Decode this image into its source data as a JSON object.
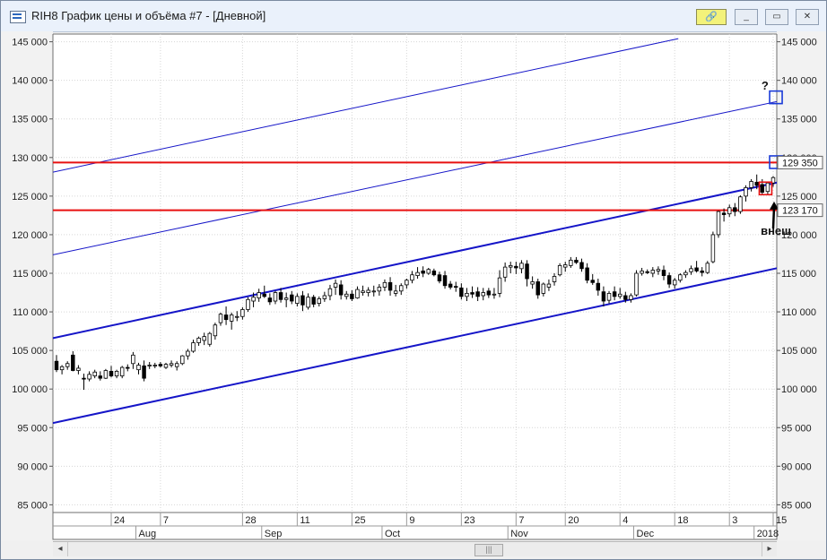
{
  "window": {
    "title": "RIH8 График цены и объёма #7 - [Дневной]",
    "icon": "chart-window-icon",
    "buttons": {
      "link": "🔗",
      "minimize": "_",
      "restore": "▭",
      "close": "✕"
    }
  },
  "chart_data": {
    "type": "candlestick",
    "title": "",
    "xlabel": "",
    "ylabel": "",
    "ylim": [
      84000,
      146000
    ],
    "y_ticks": [
      85000,
      90000,
      95000,
      100000,
      105000,
      110000,
      115000,
      120000,
      125000,
      130000,
      135000,
      140000,
      145000
    ],
    "y_tick_labels": [
      "85 000",
      "90 000",
      "95 000",
      "100 000",
      "105 000",
      "110 000",
      "115 000",
      "120 000",
      "125 000",
      "130 000",
      "135 000",
      "140 000",
      "145 000"
    ],
    "grid": true,
    "x_tick_labels": [
      {
        "label": "24",
        "bar": 10
      },
      {
        "label": "7",
        "bar": 19
      },
      {
        "label": "28",
        "bar": 34
      },
      {
        "label": "11",
        "bar": 44
      },
      {
        "label": "25",
        "bar": 54
      },
      {
        "label": "9",
        "bar": 64
      },
      {
        "label": "23",
        "bar": 74
      },
      {
        "label": "7",
        "bar": 84
      },
      {
        "label": "20",
        "bar": 93
      },
      {
        "label": "4",
        "bar": 103
      },
      {
        "label": "18",
        "bar": 113
      },
      {
        "label": "3",
        "bar": 123
      },
      {
        "label": "15",
        "bar": 131
      }
    ],
    "month_labels": [
      {
        "label": "Aug",
        "bar": 15
      },
      {
        "label": "Sep",
        "bar": 38
      },
      {
        "label": "Oct",
        "bar": 60
      },
      {
        "label": "Nov",
        "bar": 83
      },
      {
        "label": "Dec",
        "bar": 106
      },
      {
        "label": "2018",
        "bar": 128
      }
    ],
    "candles": [
      [
        103600,
        104400,
        102200,
        102500
      ],
      [
        102500,
        103100,
        101900,
        102900
      ],
      [
        102900,
        103600,
        102500,
        103300
      ],
      [
        104400,
        104900,
        102300,
        102400
      ],
      [
        102400,
        103100,
        101900,
        102700
      ],
      [
        101400,
        102000,
        99900,
        101300
      ],
      [
        101300,
        102300,
        101000,
        101900
      ],
      [
        101700,
        102500,
        101400,
        102200
      ],
      [
        101700,
        102300,
        101100,
        101400
      ],
      [
        101400,
        102600,
        101300,
        102400
      ],
      [
        102300,
        103000,
        101500,
        101700
      ],
      [
        101700,
        102500,
        101400,
        102300
      ],
      [
        101700,
        103000,
        101400,
        102800
      ],
      [
        102800,
        103200,
        102300,
        102700
      ],
      [
        103300,
        104800,
        102600,
        104400
      ],
      [
        102500,
        103400,
        101900,
        103100
      ],
      [
        103000,
        103700,
        101000,
        101400
      ],
      [
        103000,
        103500,
        102600,
        103100
      ],
      [
        103000,
        103400,
        102700,
        103100
      ],
      [
        103200,
        103500,
        102800,
        103000
      ],
      [
        102800,
        103400,
        102600,
        103200
      ],
      [
        103100,
        103700,
        102800,
        103300
      ],
      [
        102900,
        103600,
        102400,
        103300
      ],
      [
        103300,
        104400,
        103100,
        104300
      ],
      [
        104300,
        105200,
        103800,
        104900
      ],
      [
        104900,
        106400,
        104700,
        106000
      ],
      [
        106000,
        106800,
        105600,
        106600
      ],
      [
        106300,
        107300,
        105700,
        106800
      ],
      [
        105800,
        107400,
        105500,
        107200
      ],
      [
        106900,
        108600,
        106400,
        108300
      ],
      [
        108600,
        109900,
        108200,
        109700
      ],
      [
        109600,
        110700,
        108300,
        109000
      ],
      [
        108800,
        109900,
        107700,
        109600
      ],
      [
        109300,
        110100,
        108800,
        109400
      ],
      [
        109400,
        110600,
        109000,
        110300
      ],
      [
        110300,
        111900,
        110000,
        111600
      ],
      [
        111400,
        112500,
        110600,
        111900
      ],
      [
        111800,
        113000,
        111300,
        112500
      ],
      [
        112300,
        113400,
        111800,
        112000
      ],
      [
        111800,
        112400,
        110900,
        111300
      ],
      [
        111400,
        112700,
        111000,
        112500
      ],
      [
        112500,
        113100,
        111200,
        111600
      ],
      [
        111600,
        112500,
        110600,
        111800
      ],
      [
        112200,
        112700,
        111000,
        111400
      ],
      [
        111100,
        112400,
        110700,
        112000
      ],
      [
        112100,
        112700,
        110100,
        110900
      ],
      [
        110600,
        112400,
        110300,
        111900
      ],
      [
        111900,
        112200,
        110600,
        111000
      ],
      [
        111100,
        112000,
        110700,
        111700
      ],
      [
        111700,
        112600,
        111300,
        112100
      ],
      [
        112100,
        113500,
        111500,
        113000
      ],
      [
        113200,
        114200,
        112200,
        113700
      ],
      [
        113500,
        114100,
        111600,
        112200
      ],
      [
        112000,
        112700,
        111600,
        112300
      ],
      [
        112300,
        112800,
        111400,
        111700
      ],
      [
        111800,
        113300,
        111700,
        112900
      ],
      [
        112500,
        113400,
        112100,
        112700
      ],
      [
        112500,
        113200,
        112000,
        112800
      ],
      [
        112700,
        113400,
        112000,
        112700
      ],
      [
        112700,
        113600,
        112100,
        113200
      ],
      [
        113200,
        114200,
        112700,
        113800
      ],
      [
        113800,
        114500,
        112100,
        112800
      ],
      [
        112400,
        113500,
        112000,
        112700
      ],
      [
        112700,
        113700,
        112200,
        113400
      ],
      [
        113500,
        114300,
        113000,
        114100
      ],
      [
        114100,
        115300,
        113700,
        114800
      ],
      [
        114700,
        115800,
        114300,
        115100
      ],
      [
        115300,
        115900,
        114500,
        115000
      ],
      [
        115000,
        115700,
        114800,
        115500
      ],
      [
        115300,
        115600,
        114600,
        114800
      ],
      [
        114800,
        115200,
        113700,
        114000
      ],
      [
        114700,
        115300,
        113000,
        113400
      ],
      [
        113600,
        114000,
        112900,
        113200
      ],
      [
        113300,
        113900,
        112600,
        113200
      ],
      [
        113100,
        113700,
        111600,
        112000
      ],
      [
        112000,
        113100,
        111400,
        112400
      ],
      [
        112500,
        113300,
        111800,
        112300
      ],
      [
        112600,
        113200,
        111400,
        112000
      ],
      [
        112100,
        113100,
        111500,
        112500
      ],
      [
        112700,
        113100,
        111800,
        112200
      ],
      [
        112300,
        113100,
        111700,
        112300
      ],
      [
        112400,
        115400,
        111900,
        114400
      ],
      [
        114500,
        116400,
        113900,
        115800
      ],
      [
        115800,
        116500,
        115000,
        116000
      ],
      [
        115900,
        116500,
        114900,
        115700
      ],
      [
        115600,
        116700,
        115000,
        116300
      ],
      [
        116200,
        116700,
        113300,
        114300
      ],
      [
        113600,
        114600,
        113000,
        113900
      ],
      [
        113900,
        114300,
        111700,
        112200
      ],
      [
        112400,
        113800,
        112000,
        113600
      ],
      [
        113200,
        114200,
        112700,
        113600
      ],
      [
        113900,
        115000,
        113400,
        114600
      ],
      [
        114800,
        116300,
        114600,
        116000
      ],
      [
        115800,
        116500,
        115200,
        116100
      ],
      [
        116000,
        117100,
        115700,
        116700
      ],
      [
        116700,
        117100,
        116200,
        116400
      ],
      [
        116400,
        116900,
        115200,
        115600
      ],
      [
        115700,
        116300,
        113700,
        114100
      ],
      [
        114100,
        114900,
        113500,
        113800
      ],
      [
        113700,
        114300,
        112100,
        112800
      ],
      [
        112600,
        113300,
        110700,
        111400
      ],
      [
        111500,
        112700,
        111100,
        112400
      ],
      [
        112600,
        113300,
        111500,
        112000
      ],
      [
        112000,
        113100,
        111700,
        112300
      ],
      [
        112100,
        112600,
        111200,
        111600
      ],
      [
        111600,
        112400,
        111200,
        112100
      ],
      [
        112200,
        115400,
        112000,
        115000
      ],
      [
        115000,
        115700,
        114700,
        115300
      ],
      [
        115200,
        115500,
        114900,
        115100
      ],
      [
        115000,
        115800,
        114500,
        115400
      ],
      [
        115300,
        115900,
        114800,
        115500
      ],
      [
        115400,
        116000,
        114100,
        114700
      ],
      [
        114700,
        115100,
        113100,
        113600
      ],
      [
        113500,
        114400,
        113000,
        114100
      ],
      [
        114100,
        115000,
        113800,
        114800
      ],
      [
        114800,
        115400,
        114400,
        115100
      ],
      [
        115200,
        116000,
        114800,
        115600
      ],
      [
        115700,
        116600,
        115100,
        115300
      ],
      [
        115300,
        115800,
        114600,
        115100
      ],
      [
        115100,
        116600,
        114900,
        116300
      ],
      [
        116500,
        120400,
        116300,
        120000
      ],
      [
        120000,
        123100,
        119600,
        123000
      ],
      [
        122800,
        123400,
        121700,
        122600
      ],
      [
        122700,
        123900,
        122300,
        123500
      ],
      [
        123500,
        124100,
        122400,
        123000
      ],
      [
        123000,
        125100,
        122700,
        124900
      ],
      [
        125000,
        126400,
        124300,
        126100
      ],
      [
        126100,
        127200,
        125600,
        126900
      ],
      [
        126800,
        127800,
        125900,
        126400
      ],
      [
        126500,
        127200,
        125100,
        125500
      ],
      [
        125600,
        126900,
        125100,
        126700
      ],
      [
        126700,
        127600,
        126200,
        127400
      ]
    ],
    "lines": [
      {
        "name": "",
        "color": "#1515c8",
        "width": 2,
        "points": [
          [
            0,
            106600
          ],
          [
            132,
            126900
          ]
        ]
      },
      {
        "name": "",
        "color": "#1515c8",
        "width": 2,
        "points": [
          [
            0,
            95600
          ],
          [
            132,
            115800
          ]
        ]
      },
      {
        "name": "",
        "color": "#1515c8",
        "width": 1,
        "points": [
          [
            0,
            117400
          ],
          [
            132,
            137400
          ]
        ]
      },
      {
        "name": "",
        "color": "#1515c8",
        "width": 1,
        "points": [
          [
            0,
            128100
          ],
          [
            113,
            145400
          ]
        ]
      },
      {
        "name": "",
        "color": "#e81010",
        "width": 2,
        "points": [
          [
            0,
            129350
          ],
          [
            132,
            129350
          ]
        ]
      },
      {
        "name": "",
        "color": "#e81010",
        "width": 2,
        "points": [
          [
            0,
            123170
          ],
          [
            132,
            123170
          ]
        ]
      }
    ],
    "price_tags": [
      {
        "value": 129350,
        "label": "129 350"
      },
      {
        "value": 123170,
        "label": "123 170"
      }
    ],
    "annotations": [
      {
        "text": "?",
        "bar": 129.5,
        "value": 138800
      },
      {
        "text": "внеш",
        "bar": 131.5,
        "value": 120000
      }
    ],
    "markers": [
      {
        "kind": "square",
        "color": "#1a3bd8",
        "bar": 131.5,
        "value": 137800
      },
      {
        "kind": "square",
        "color": "#1a3bd8",
        "bar": 131.5,
        "value": 129400
      },
      {
        "kind": "square",
        "color": "#e81010",
        "bar": 129.6,
        "value": 126000
      }
    ],
    "arrow": {
      "color": "#000000",
      "bar": 131.0,
      "from_value": 120800,
      "to_value": 124300
    }
  },
  "scrollbar": {
    "left_arrow": "◂",
    "right_arrow": "▸",
    "thumb": "|||"
  }
}
